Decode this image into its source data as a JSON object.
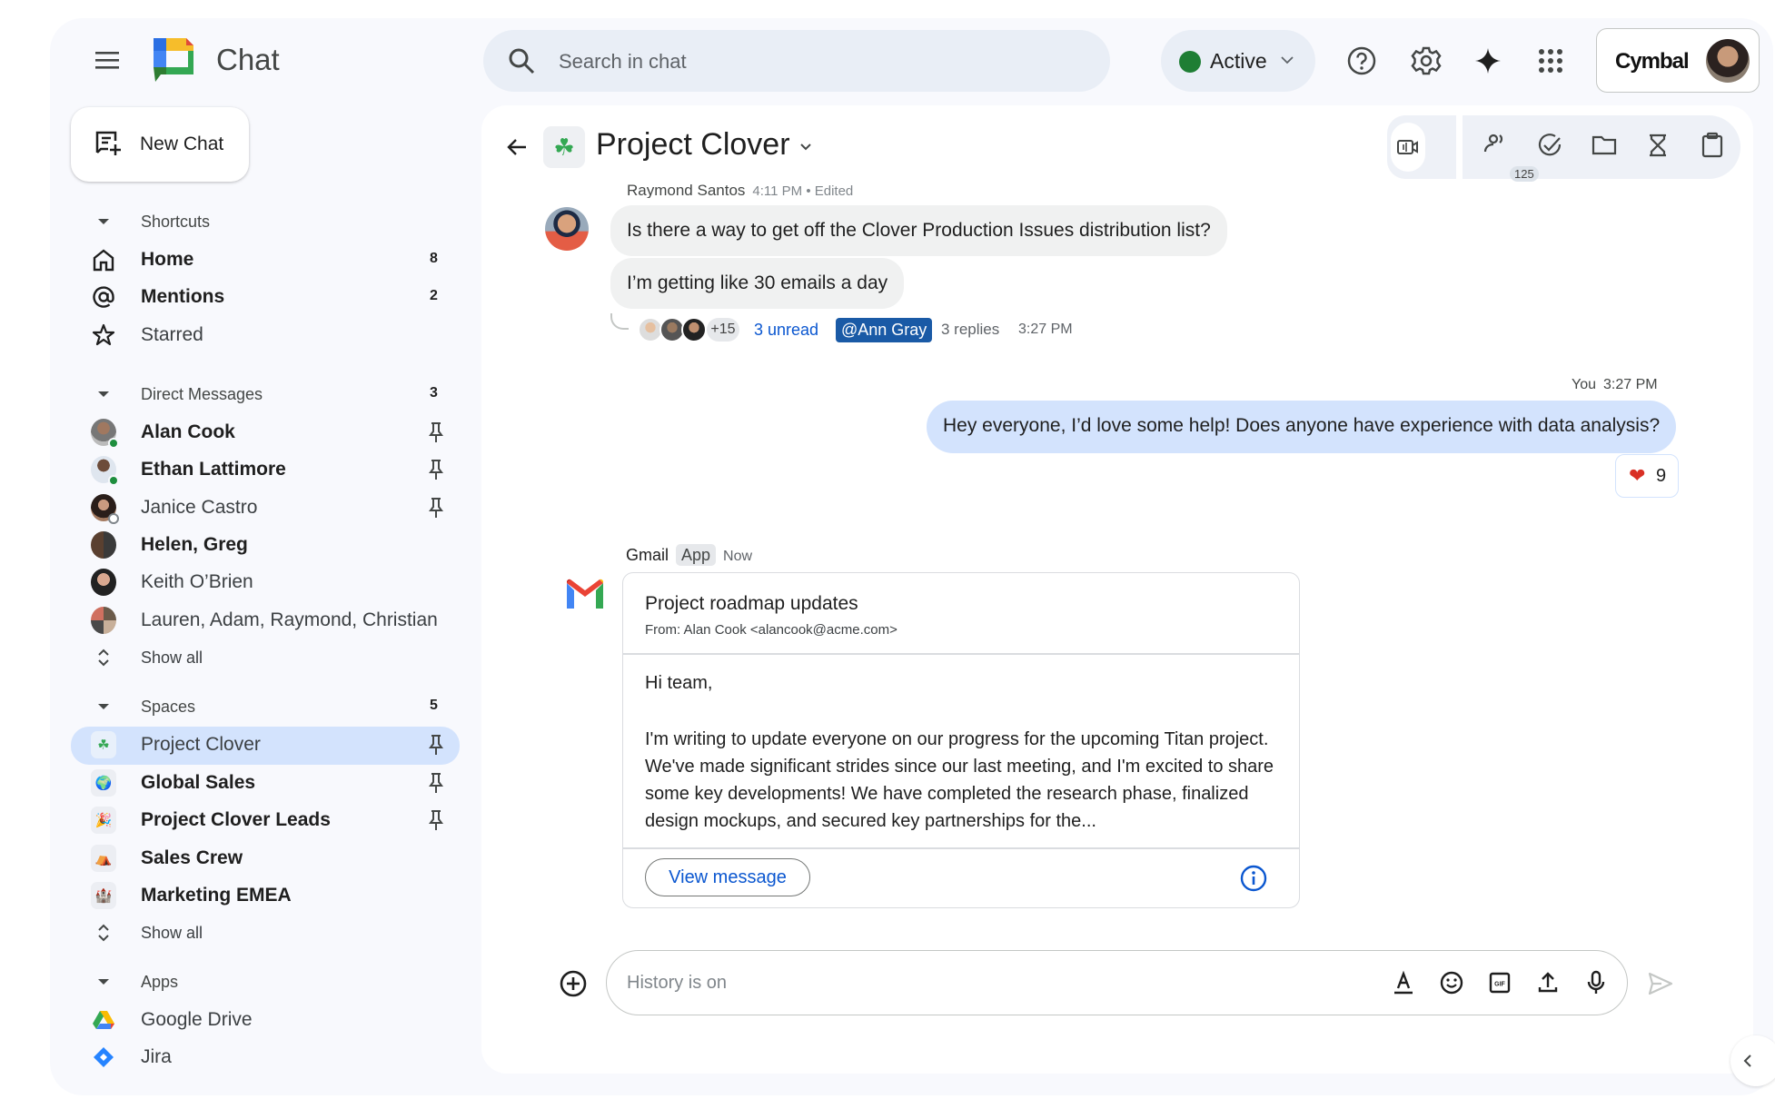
{
  "app": {
    "title": "Chat",
    "search_placeholder": "Search in chat",
    "status": {
      "label": "Active",
      "color": "#1e7e34"
    },
    "brand": "Cymbal",
    "icons": [
      "menu-icon",
      "search-icon",
      "help-icon",
      "settings-icon",
      "gemini-sparkle-icon",
      "apps-grid-icon"
    ]
  },
  "sidebar": {
    "new_chat_label": "New Chat",
    "shortcuts": {
      "label": "Shortcuts",
      "items": [
        {
          "label": "Home",
          "icon": "home-icon",
          "count": "8",
          "bold": true
        },
        {
          "label": "Mentions",
          "icon": "at-icon",
          "count": "2",
          "bold": true
        },
        {
          "label": "Starred",
          "icon": "star-icon",
          "count": "",
          "bold": false
        }
      ]
    },
    "direct_messages": {
      "label": "Direct Messages",
      "count": "3",
      "items": [
        {
          "label": "Alan Cook",
          "bold": true,
          "pinned": true,
          "presence": "online"
        },
        {
          "label": "Ethan Lattimore",
          "bold": true,
          "pinned": true,
          "presence": "online"
        },
        {
          "label": "Janice Castro",
          "bold": false,
          "pinned": true,
          "presence": "away"
        },
        {
          "label": "Helen, Greg",
          "bold": true,
          "pinned": false,
          "presence": ""
        },
        {
          "label": "Keith O’Brien",
          "bold": false,
          "pinned": false,
          "presence": ""
        },
        {
          "label": "Lauren, Adam, Raymond, Christian",
          "bold": false,
          "pinned": false,
          "presence": ""
        }
      ],
      "show_all_label": "Show all"
    },
    "spaces": {
      "label": "Spaces",
      "count": "5",
      "items": [
        {
          "label": "Project Clover",
          "emoji": "☘",
          "bold": false,
          "pinned": true,
          "selected": true
        },
        {
          "label": "Global Sales",
          "emoji": "🌍",
          "bold": true,
          "pinned": true,
          "selected": false
        },
        {
          "label": "Project Clover Leads",
          "emoji": "🎉",
          "bold": true,
          "pinned": true,
          "selected": false
        },
        {
          "label": "Sales Crew",
          "emoji": "⛺",
          "bold": true,
          "pinned": false,
          "selected": false
        },
        {
          "label": "Marketing EMEA",
          "emoji": "🏰",
          "bold": true,
          "pinned": false,
          "selected": false
        }
      ],
      "show_all_label": "Show all"
    },
    "apps": {
      "label": "Apps",
      "items": [
        {
          "label": "Google Drive",
          "icon": "google-drive-icon"
        },
        {
          "label": "Jira",
          "icon": "jira-icon"
        }
      ]
    }
  },
  "conversation": {
    "title": "Project Clover",
    "title_emoji": "☘",
    "members_count": "125",
    "header_tools": [
      "meet-icon",
      "members-icon",
      "tasks-icon",
      "files-icon",
      "timer-icon",
      "clipboard-icon"
    ],
    "messages": [
      {
        "sender": "Raymond Santos",
        "time": "4:11 PM • Edited",
        "bubbles": [
          "Is there a way to get off the Clover Production Issues distribution list?",
          "I’m getting like 30 emails a day"
        ],
        "thread": {
          "extra_participants": "+15",
          "unread": "3 unread",
          "mention": "@Ann Gray",
          "replies": "3 replies",
          "time": "3:27 PM"
        }
      },
      {
        "sender": "You",
        "time": "3:27 PM",
        "text": "Hey everyone, I’d love some help!  Does anyone have experience with data analysis?",
        "reaction": {
          "emoji": "❤",
          "count": "9"
        }
      },
      {
        "sender": "Gmail",
        "badge": "App",
        "time": "Now",
        "card": {
          "subject": "Project roadmap updates",
          "from": "From: Alan Cook <alancook@acme.com>",
          "greeting": "Hi team,",
          "body": "I'm writing to update everyone on our progress for the upcoming Titan project. We've made significant strides since our last meeting, and I'm excited to share some key developments! We have completed the research phase, finalized design mockups, and secured key partnerships for the...",
          "button_label": "View message"
        }
      }
    ],
    "composer": {
      "placeholder": "History is on",
      "tools": [
        "format-text-icon",
        "emoji-icon",
        "gif-icon",
        "upload-icon",
        "mic-icon"
      ]
    }
  },
  "colors": {
    "accent": "#0b57d0",
    "selected_bg": "#d3e3fd",
    "panel_bg": "#f8f9fd",
    "mention_bg": "#1a5aa6"
  }
}
